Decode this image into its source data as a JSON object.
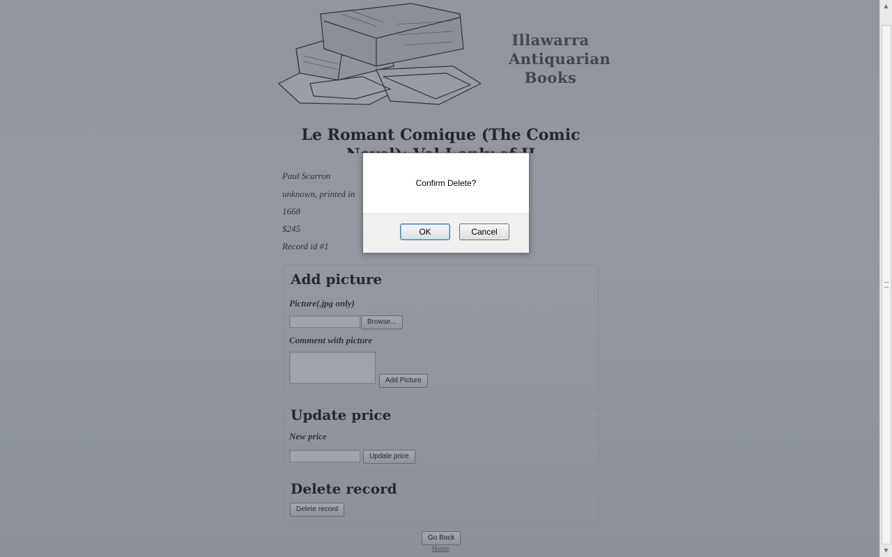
{
  "header": {
    "store_name_line1": "Illawarra",
    "store_name_line2": "Antiquarian",
    "store_name_line3": "Books"
  },
  "book": {
    "title": "Le Romant Comique (The Comic Novel): Vol I only of II",
    "author": "Paul Scarron",
    "publisher": "unknown, printed in",
    "year": "1668",
    "price": "$245",
    "record_id": "Record id #1"
  },
  "add_picture": {
    "heading": "Add picture",
    "picture_label": "Picture(.jpg only)",
    "browse_label": "Browse...",
    "comment_label": "Comment with picture",
    "submit_label": "Add Picture"
  },
  "update_price": {
    "heading": "Update price",
    "new_price_label": "New price",
    "submit_label": "Update price"
  },
  "delete_record": {
    "heading": "Delete record",
    "submit_label": "Delete record"
  },
  "footer": {
    "go_back_label": "Go Back",
    "home_link": "Home"
  },
  "dialog": {
    "message": "Confirm Delete?",
    "ok_label": "OK",
    "cancel_label": "Cancel"
  }
}
